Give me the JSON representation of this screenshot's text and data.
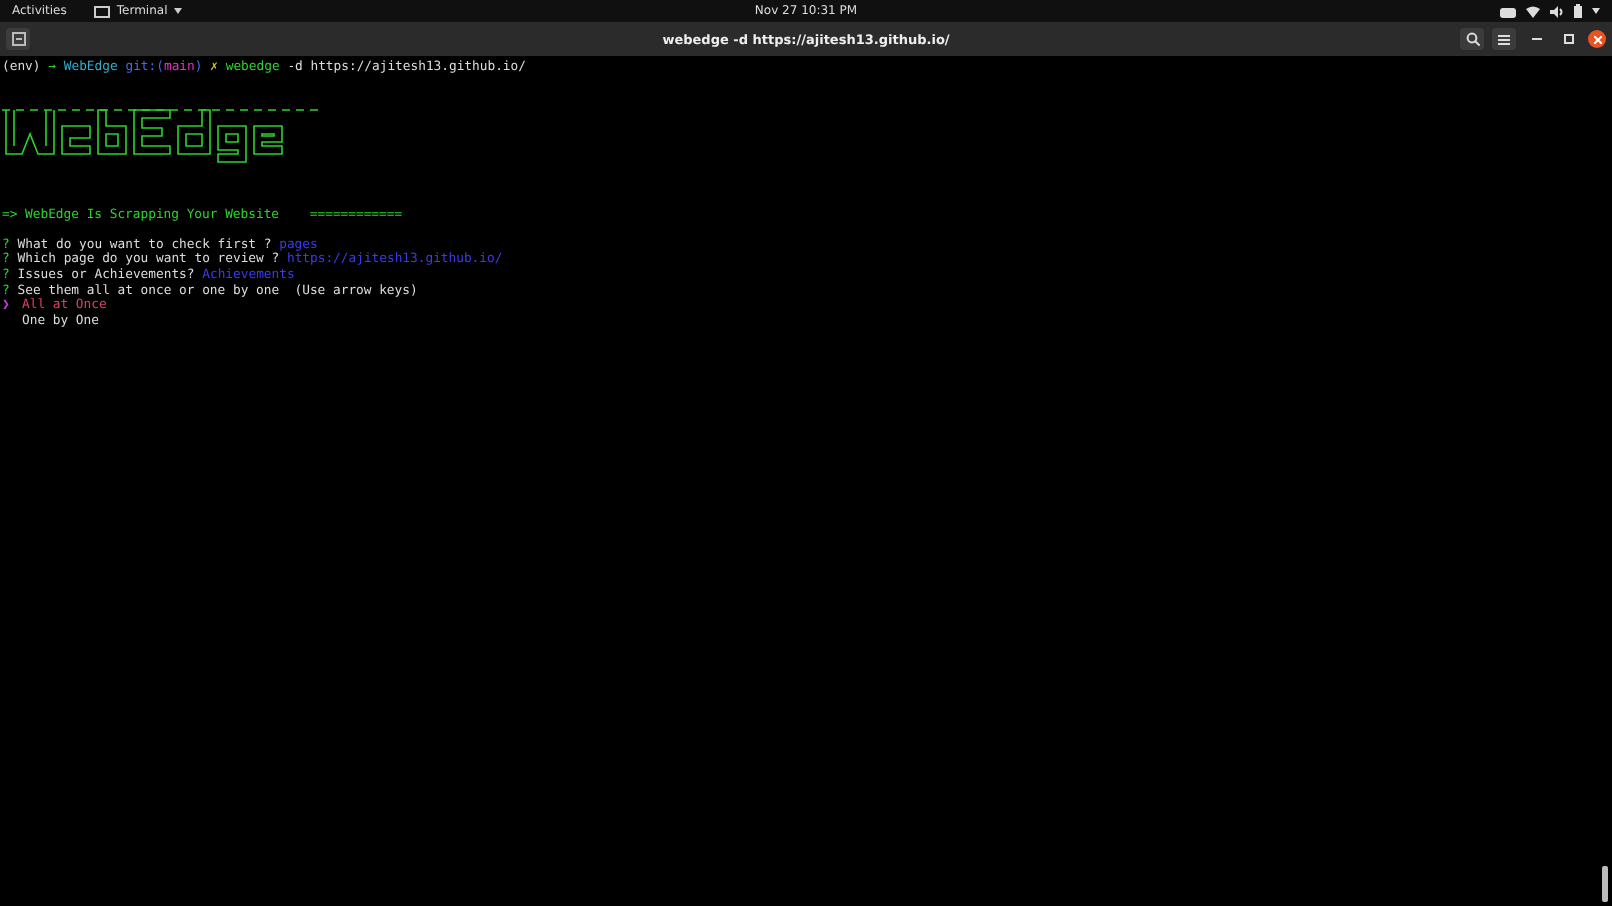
{
  "top_bar": {
    "activities": "Activities",
    "app_menu": "Terminal",
    "clock": "Nov 27  10:31 PM"
  },
  "window": {
    "title": "webedge -d https://ajitesh13.github.io/"
  },
  "terminal": {
    "lines": [
      {
        "kind": "text",
        "segments": [
          {
            "text": "(env)",
            "kind": "plain"
          },
          {
            "text": "→",
            "kind": "arrow"
          },
          {
            "text": "WebEdge",
            "kind": "dir"
          },
          {
            "text": "git:(",
            "kind": "git"
          },
          {
            "text": "main",
            "kind": "branch"
          },
          {
            "text": ")",
            "kind": "git"
          },
          {
            "text": "✗",
            "kind": "dirty"
          },
          {
            "text": "webedge",
            "kind": "command"
          },
          {
            "text": "-d https://ajitesh13.github.io/",
            "kind": "plain"
          }
        ]
      },
      {
        "kind": "banner"
      },
      {
        "kind": "text",
        "segments": [
          {
            "text": "=> WebEdge Is Scrapping Your Website    ============",
            "kind": "info"
          }
        ]
      },
      {
        "kind": "text",
        "segments": [
          {
            "text": "?",
            "kind": "mark"
          },
          {
            "text": "What do you want to check first ?",
            "kind": "plain"
          },
          {
            "text": "pages",
            "kind": "answer"
          }
        ]
      },
      {
        "kind": "text",
        "segments": [
          {
            "text": "?",
            "kind": "mark"
          },
          {
            "text": "Which page do you want to review ?",
            "kind": "plain"
          },
          {
            "text": "https://ajitesh13.github.io/",
            "kind": "answer"
          }
        ]
      },
      {
        "kind": "text",
        "segments": [
          {
            "text": "?",
            "kind": "mark"
          },
          {
            "text": "Issues or Achievements?",
            "kind": "plain"
          },
          {
            "text": "Achievements",
            "kind": "answer"
          }
        ]
      },
      {
        "kind": "text",
        "segments": [
          {
            "text": "?",
            "kind": "mark"
          },
          {
            "text": "See them all at once or one by one  (Use arrow keys)",
            "kind": "plain"
          }
        ]
      },
      {
        "kind": "choice",
        "pointer": "❯",
        "text": "All at Once",
        "selected": true
      },
      {
        "kind": "choice",
        "text": "One by One",
        "selected": false
      }
    ]
  }
}
